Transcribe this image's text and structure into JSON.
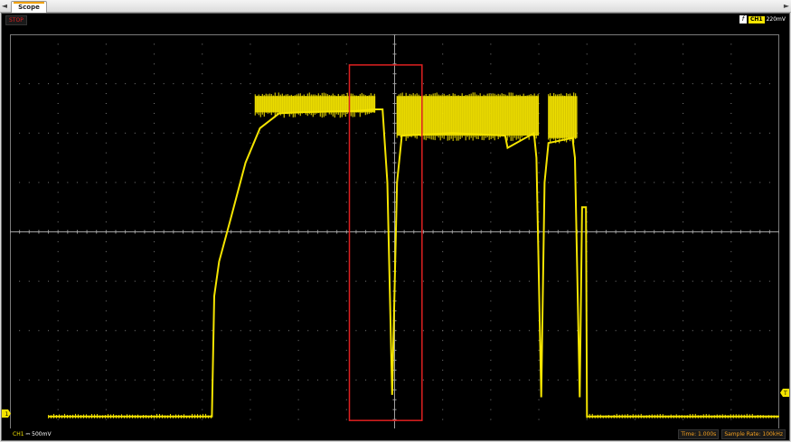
{
  "tabs": [
    {
      "label": "Scope"
    }
  ],
  "nav": {
    "left_arrow": "◄",
    "right_arrow": "►"
  },
  "status": {
    "run_state": "STOP"
  },
  "trigger": {
    "icon": "trigger-edge-icon",
    "channel": "CH1",
    "level": "220mV"
  },
  "channel": {
    "name": "CH1",
    "coupling": "⎓",
    "scale": "500mV"
  },
  "timebase": {
    "time": "Time: 1.000s",
    "sample_rate": "Sample Rate: 100kHz"
  },
  "channel_marker": {
    "label": "1"
  },
  "trigger_marker": {
    "label": "T"
  },
  "colors": {
    "trace": "#f4e400",
    "highlight_box": "#e02020",
    "grid": "#7a7a7a",
    "background": "#000000"
  },
  "trace_data": {
    "units": "divisions",
    "divisions": {
      "x": 16,
      "y": 8
    },
    "samples": [
      [
        0.8,
        -3.74
      ],
      [
        4.2,
        -3.74
      ],
      [
        4.25,
        -1.3
      ],
      [
        4.35,
        -0.6
      ],
      [
        4.6,
        0.3
      ],
      [
        4.9,
        1.4
      ],
      [
        5.2,
        2.1
      ],
      [
        5.6,
        2.4
      ],
      [
        6.0,
        2.42
      ],
      [
        7.2,
        2.45
      ],
      [
        7.6,
        2.48
      ],
      [
        7.75,
        2.48
      ],
      [
        7.85,
        1.0
      ],
      [
        7.95,
        -3.3
      ],
      [
        8.05,
        1.0
      ],
      [
        8.15,
        1.95
      ],
      [
        9.2,
        2.0
      ],
      [
        10.3,
        1.95
      ],
      [
        10.35,
        1.7
      ],
      [
        10.9,
        2.0
      ],
      [
        10.95,
        1.5
      ],
      [
        11.05,
        -3.35
      ],
      [
        11.12,
        1.0
      ],
      [
        11.2,
        1.8
      ],
      [
        11.7,
        1.9
      ],
      [
        11.75,
        1.5
      ],
      [
        11.85,
        -3.35
      ],
      [
        11.9,
        0.5
      ],
      [
        11.98,
        0.5
      ],
      [
        12.0,
        -3.74
      ],
      [
        16.0,
        -3.74
      ]
    ],
    "noise_bands": [
      {
        "x_start": 5.1,
        "x_end": 7.6,
        "y_low": 2.42,
        "y_high": 2.75
      },
      {
        "x_start": 8.05,
        "x_end": 11.0,
        "y_low": 1.95,
        "y_high": 2.75
      },
      {
        "x_start": 11.2,
        "x_end": 11.8,
        "y_low": 1.9,
        "y_high": 2.75
      }
    ]
  },
  "highlight_region": {
    "x_start_div": 7.06,
    "x_end_div": 8.57,
    "y_top_div": 3.38,
    "y_bottom_div": -3.82
  }
}
